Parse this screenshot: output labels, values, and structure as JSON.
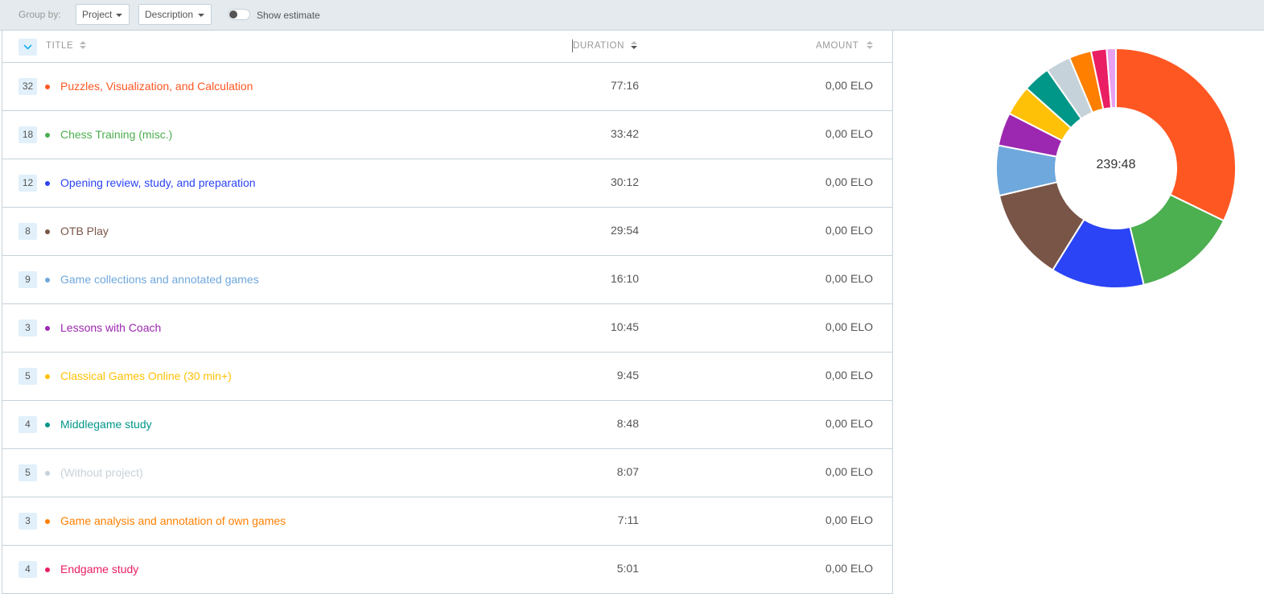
{
  "toolbar": {
    "group_by_label": "Group by:",
    "group1": "Project",
    "group2": "Description",
    "show_estimate_label": "Show estimate",
    "show_estimate_on": false
  },
  "table": {
    "col_title": "TITLE",
    "col_duration": "DURATION",
    "col_amount": "AMOUNT",
    "rows": [
      {
        "count": "32",
        "title": "Puzzles, Visualization, and Calculation",
        "duration": "77:16",
        "amount": "0,00 ELO",
        "color": "#ff5722"
      },
      {
        "count": "18",
        "title": "Chess Training (misc.)",
        "duration": "33:42",
        "amount": "0,00 ELO",
        "color": "#4caf50"
      },
      {
        "count": "12",
        "title": "Opening review, study, and preparation",
        "duration": "30:12",
        "amount": "0,00 ELO",
        "color": "#2b44f5"
      },
      {
        "count": "8",
        "title": "OTB Play",
        "duration": "29:54",
        "amount": "0,00 ELO",
        "color": "#795548"
      },
      {
        "count": "9",
        "title": "Game collections and annotated games",
        "duration": "16:10",
        "amount": "0,00 ELO",
        "color": "#6fa8dc"
      },
      {
        "count": "3",
        "title": "Lessons with Coach",
        "duration": "10:45",
        "amount": "0,00 ELO",
        "color": "#9c27b0"
      },
      {
        "count": "5",
        "title": "Classical Games Online (30 min+)",
        "duration": "9:45",
        "amount": "0,00 ELO",
        "color": "#ffc107"
      },
      {
        "count": "4",
        "title": "Middlegame study",
        "duration": "8:48",
        "amount": "0,00 ELO",
        "color": "#009688"
      },
      {
        "count": "5",
        "title": "(Without project)",
        "duration": "8:07",
        "amount": "0,00 ELO",
        "color": "#c6d2d9"
      },
      {
        "count": "3",
        "title": "Game analysis and annotation of own games",
        "duration": "7:11",
        "amount": "0,00 ELO",
        "color": "#ff7f00"
      },
      {
        "count": "4",
        "title": "Endgame study",
        "duration": "5:01",
        "amount": "0,00 ELO",
        "color": "#e91e63"
      }
    ]
  },
  "chart_data": {
    "type": "pie",
    "total_label": "239:48",
    "slices": [
      {
        "label": "Puzzles, Visualization, and Calculation",
        "minutes": 4636,
        "color": "#ff5722"
      },
      {
        "label": "Chess Training (misc.)",
        "minutes": 2022,
        "color": "#4caf50"
      },
      {
        "label": "Opening review, study, and preparation",
        "minutes": 1812,
        "color": "#2b44f5"
      },
      {
        "label": "OTB Play",
        "minutes": 1794,
        "color": "#795548"
      },
      {
        "label": "Game collections and annotated games",
        "minutes": 970,
        "color": "#6fa8dc"
      },
      {
        "label": "Lessons with Coach",
        "minutes": 645,
        "color": "#9c27b0"
      },
      {
        "label": "Classical Games Online (30 min+)",
        "minutes": 585,
        "color": "#ffc107"
      },
      {
        "label": "Middlegame study",
        "minutes": 528,
        "color": "#009688"
      },
      {
        "label": "(Without project)",
        "minutes": 487,
        "color": "#c6d2d9"
      },
      {
        "label": "Game analysis and annotation of own games",
        "minutes": 431,
        "color": "#ff7f00"
      },
      {
        "label": "Endgame study",
        "minutes": 301,
        "color": "#e91e63"
      },
      {
        "label": "",
        "minutes": 180,
        "color": "#e8a0f0"
      }
    ]
  }
}
